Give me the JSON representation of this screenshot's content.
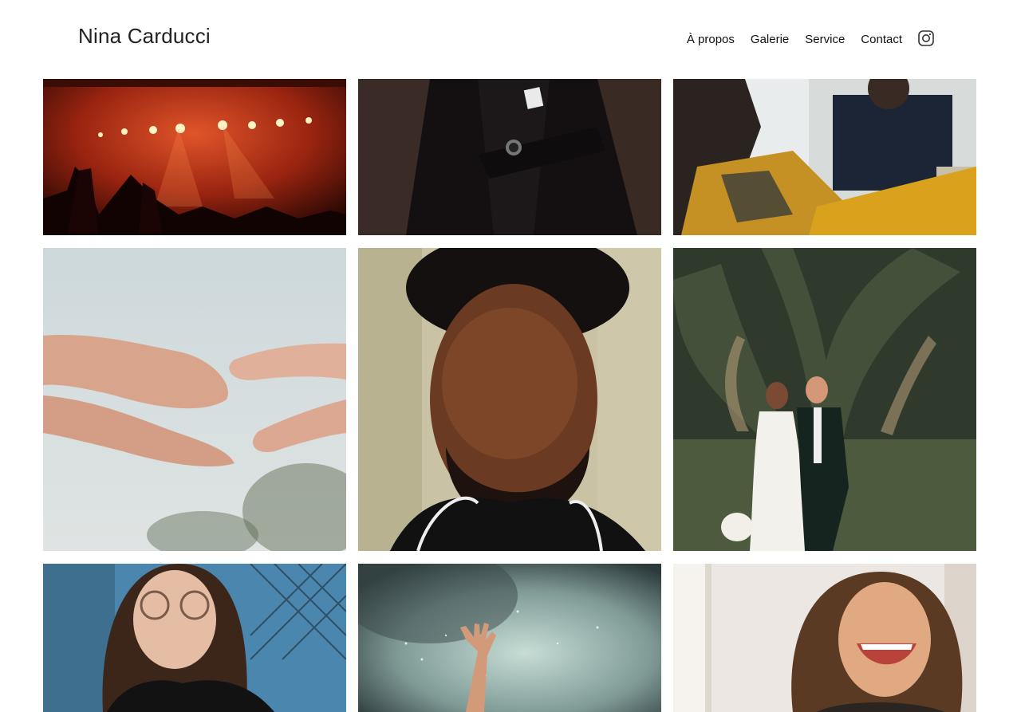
{
  "site": {
    "brand": "Nina Carducci"
  },
  "nav": {
    "items": [
      {
        "label": "À propos"
      },
      {
        "label": "Galerie"
      },
      {
        "label": "Service"
      },
      {
        "label": "Contact"
      }
    ],
    "instagram_icon": "instagram-icon"
  },
  "colors": {
    "background": "#ffffff",
    "text": "#222222"
  },
  "gallery": {
    "photos": [
      {
        "subject": "concert"
      },
      {
        "subject": "man-in-suit"
      },
      {
        "subject": "people-at-table"
      },
      {
        "subject": "hands-reaching"
      },
      {
        "subject": "portrait-man"
      },
      {
        "subject": "wedding-couple"
      },
      {
        "subject": "woman-glasses"
      },
      {
        "subject": "hand-in-smoke"
      },
      {
        "subject": "laughing-woman"
      }
    ]
  }
}
